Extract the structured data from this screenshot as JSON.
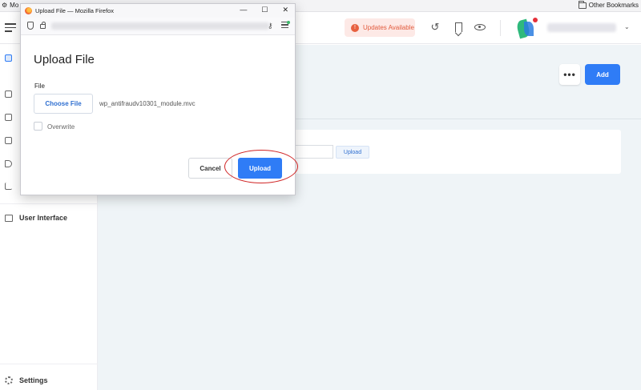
{
  "browser": {
    "tab_fragment": "Mo",
    "other_bookmarks": "Other Bookmarks"
  },
  "header": {
    "updates_label": "Updates Available"
  },
  "sidebar": {
    "item_user_interface": "User Interface",
    "item_settings": "Settings"
  },
  "main": {
    "more_label": "•••",
    "add_label": "Add",
    "card_upload_label": "Upload"
  },
  "dialog": {
    "window_title": "Upload File — Mozilla Firefox",
    "heading": "Upload File",
    "file_label": "File",
    "choose_file_label": "Choose File",
    "filename": "wp_antifraudv10301_module.mvc",
    "overwrite_label": "Overwrite",
    "cancel_label": "Cancel",
    "upload_label": "Upload"
  },
  "colors": {
    "accent": "#2f7cf6",
    "updates_text": "#e25a3c",
    "annotation": "#d02424"
  }
}
